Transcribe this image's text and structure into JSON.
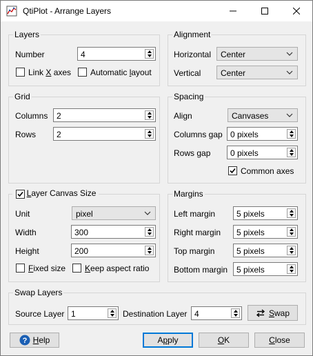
{
  "window": {
    "title": "QtiPlot - Arrange Layers"
  },
  "layers": {
    "group_title": "Layers",
    "number_label": "Number",
    "number_value": "4",
    "link_x_pre": "Link ",
    "link_x_u": "X",
    "link_x_post": " axes",
    "auto_pre": "Automatic ",
    "auto_u": "l",
    "auto_post": "ayout"
  },
  "alignment": {
    "group_title": "Alignment",
    "horizontal_label": "Horizontal",
    "horizontal_value": "Center",
    "vertical_label": "Vertical",
    "vertical_value": "Center"
  },
  "grid": {
    "group_title": "Grid",
    "columns_label": "Columns",
    "columns_value": "2",
    "rows_label": "Rows",
    "rows_value": "2"
  },
  "spacing": {
    "group_title": "Spacing",
    "align_label": "Align",
    "align_value": "Canvases",
    "columns_gap_label": "Columns gap",
    "columns_gap_value": "0 pixels",
    "rows_gap_label": "Rows gap",
    "rows_gap_value": "0 pixels",
    "common_axes_label": "Common axes",
    "common_axes_checked": true
  },
  "canvas_size": {
    "group_title_u": "L",
    "group_title_post": "ayer Canvas Size",
    "enabled": true,
    "unit_label": "Unit",
    "unit_value": "pixel",
    "width_label": "Width",
    "width_value": "300",
    "height_label": "Height",
    "height_value": "200",
    "fixed_u": "F",
    "fixed_post": "ixed size",
    "keep_u": "K",
    "keep_post": "eep aspect ratio"
  },
  "margins": {
    "group_title": "Margins",
    "left_label": "Left margin",
    "left_value": "5 pixels",
    "right_label": "Right margin",
    "right_value": "5 pixels",
    "top_label": "Top margin",
    "top_value": "5 pixels",
    "bottom_label": "Bottom margin",
    "bottom_value": "5 pixels"
  },
  "swap": {
    "group_title": "Swap Layers",
    "source_label": "Source Layer",
    "source_value": "1",
    "dest_label": "Destination Layer",
    "dest_value": "4",
    "swap_u": "S",
    "swap_post": "wap"
  },
  "buttons": {
    "help_u": "H",
    "help_post": "elp",
    "apply_pre": "A",
    "apply_u": "p",
    "apply_post": "ply",
    "ok_u": "O",
    "ok_post": "K",
    "close_u": "C",
    "close_post": "lose"
  },
  "icons": {
    "app": "qtiplot-app-icon",
    "minimize": "minimize-icon",
    "maximize": "maximize-icon",
    "close": "close-icon",
    "help": "help-icon",
    "swap": "swap-arrows-icon"
  },
  "colors": {
    "accent": "#0078d7",
    "help_icon": "#1a5fb4"
  }
}
